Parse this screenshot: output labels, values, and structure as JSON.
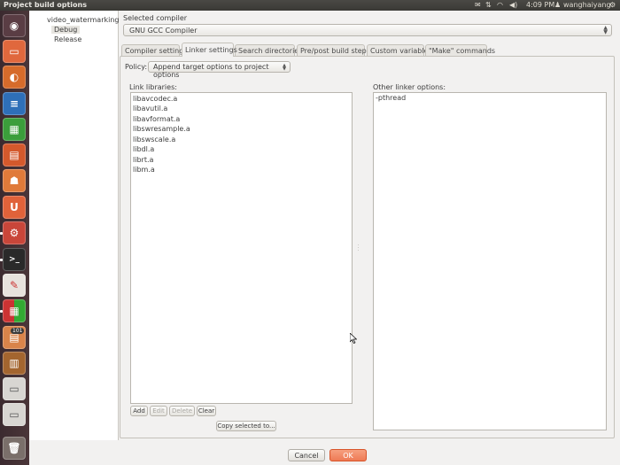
{
  "window": {
    "title": "Project build options"
  },
  "topbar": {
    "time": "4:09 PM",
    "user": "wanghaiyang"
  },
  "launcher": {
    "items": [
      "dash-home",
      "files",
      "firefox",
      "writer",
      "calc",
      "impress",
      "software-center",
      "ubuntu-one",
      "settings",
      "terminal",
      "text-editor",
      "app-grid",
      "updates",
      "workspace",
      "drive",
      "drive",
      "trash"
    ],
    "update_badge": "101"
  },
  "tree": {
    "project": "video_watermarking",
    "targets": [
      "Debug",
      "Release"
    ]
  },
  "compiler": {
    "label": "Selected compiler",
    "value": "GNU GCC Compiler"
  },
  "tabs": [
    {
      "label": "Compiler settings"
    },
    {
      "label": "Linker settings"
    },
    {
      "label": "Search directories"
    },
    {
      "label": "Pre/post build steps"
    },
    {
      "label": "Custom variables"
    },
    {
      "label": "\"Make\" commands"
    }
  ],
  "policy": {
    "label": "Policy:",
    "value": "Append target options to project options"
  },
  "link_libraries": {
    "label": "Link libraries:",
    "items": [
      "libavcodec.a",
      "libavutil.a",
      "libavformat.a",
      "libswresample.a",
      "libswscale.a",
      "libdl.a",
      "librt.a",
      "libm.a"
    ],
    "buttons": {
      "add": "Add",
      "edit": "Edit",
      "delete": "Delete",
      "clear": "Clear",
      "copy": "Copy selected to..."
    }
  },
  "other_linker": {
    "label": "Other linker options:",
    "value": "-pthread"
  },
  "dialog": {
    "cancel": "Cancel",
    "ok": "OK"
  },
  "colors": {
    "accent_ok": "#ee7a55",
    "launcher_bg": "#3b2a2f",
    "panel_bg": "#3a3935"
  }
}
